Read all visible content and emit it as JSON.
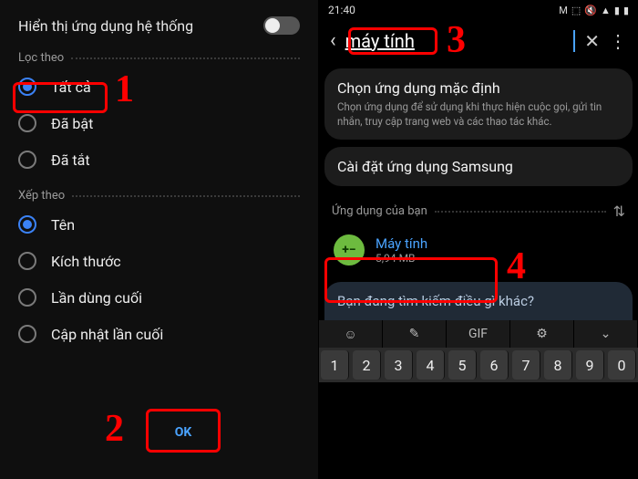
{
  "left": {
    "header": "Hiển thị ứng dụng hệ thống",
    "filter_section": "Lọc theo",
    "sort_section": "Xếp theo",
    "filter_options": [
      "Tất cả",
      "Đã bật",
      "Đã tắt"
    ],
    "sort_options": [
      "Tên",
      "Kích thước",
      "Lần dùng cuối",
      "Cập nhật lần cuối"
    ],
    "ok": "OK"
  },
  "right": {
    "time": "21:40",
    "search_value": "máy tính",
    "card1_title": "Chọn ứng dụng mặc định",
    "card1_sub": "Chọn ứng dụng để sử dụng khi thực hiện cuộc gọi, gửi tin nhắn, truy cập trang web và các thao tác khác.",
    "card2_title": "Cài đặt ứng dụng Samsung",
    "apps_header": "Ứng dụng của bạn",
    "app_name": "Máy tính",
    "app_size": "5,94 MB",
    "suggest": "Bạn đang tìm kiếm điều gì khác?",
    "kb_icons": [
      "☺",
      "✎",
      "GIF",
      "⚙",
      "⌄"
    ],
    "kb_nums": [
      "1",
      "2",
      "3",
      "4",
      "5",
      "6",
      "7",
      "8",
      "9",
      "0"
    ]
  },
  "callouts": {
    "n1": "1",
    "n2": "2",
    "n3": "3",
    "n4": "4"
  }
}
